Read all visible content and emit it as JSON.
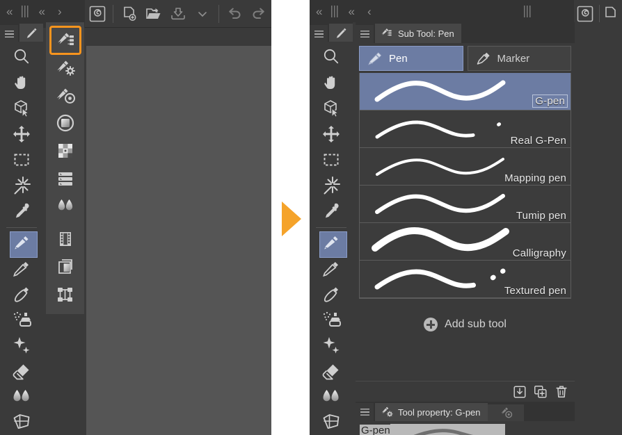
{
  "app": {
    "name": "Clip Studio Paint",
    "accent_orange": "#f7941e",
    "accent_blue": "#6c7ca3",
    "panel_bg": "#3a3a3a",
    "window_bg": "#333333",
    "canvas_bg": "#555555"
  },
  "left_window": {
    "navbar": {
      "collapse_all": "«",
      "grip": "grip",
      "collapse": "«",
      "expand": "›"
    },
    "command_bar": {
      "items": [
        {
          "name": "csp-logo-icon",
          "label": "Clip Studio Paint"
        },
        {
          "name": "new-file-icon",
          "label": "New"
        },
        {
          "name": "open-file-icon",
          "label": "Open"
        },
        {
          "name": "save-icon",
          "label": "Save"
        },
        {
          "name": "chevron-down-icon",
          "label": "More"
        },
        {
          "name": "undo-icon",
          "label": "Undo"
        },
        {
          "name": "redo-icon",
          "label": "Redo"
        }
      ]
    },
    "tool_tab": {
      "menu": "menu-icon",
      "icon": "pencil-icon"
    },
    "tools": [
      {
        "name": "zoom-tool",
        "label": "Zoom",
        "selected": false
      },
      {
        "name": "move-canvas-tool",
        "label": "Move canvas",
        "selected": false
      },
      {
        "name": "rotate-3d-tool",
        "label": "Object",
        "selected": false
      },
      {
        "name": "move-tool",
        "label": "Move layer",
        "selected": false
      },
      {
        "name": "selection-tool",
        "label": "Selection area",
        "selected": false
      },
      {
        "name": "auto-select-tool",
        "label": "Auto select",
        "selected": false
      },
      {
        "name": "eyedropper-tool",
        "label": "Eyedropper",
        "selected": false
      },
      {
        "name": "pen-tool",
        "label": "Pen",
        "selected": true
      },
      {
        "name": "pencil-tool",
        "label": "Pencil",
        "selected": false
      },
      {
        "name": "brush-tool",
        "label": "Brush",
        "selected": false
      },
      {
        "name": "airbrush-tool",
        "label": "Airbrush",
        "selected": false
      },
      {
        "name": "decoration-tool",
        "label": "Decoration",
        "selected": false
      },
      {
        "name": "eraser-tool",
        "label": "Eraser",
        "selected": false
      },
      {
        "name": "blend-tool",
        "label": "Blend",
        "selected": false
      },
      {
        "name": "gradient-tool",
        "label": "Gradient",
        "selected": false
      }
    ],
    "sub_tool_icons": [
      {
        "name": "sub-tool-list-icon",
        "label": "Sub Tool",
        "highlighted": true
      },
      {
        "name": "tool-property-icon",
        "label": "Tool property",
        "highlighted": false
      },
      {
        "name": "brush-settings-icon",
        "label": "Sub Tool Detail",
        "highlighted": false
      },
      {
        "name": "color-circle-icon",
        "label": "Color Wheel",
        "highlighted": false
      },
      {
        "name": "color-set-icon",
        "label": "Color Set",
        "highlighted": false
      },
      {
        "name": "layer-property-icon",
        "label": "Layer Property",
        "highlighted": false
      },
      {
        "name": "gradient-set-icon",
        "label": "Gradient",
        "highlighted": false
      },
      {
        "name": "timeline-icon",
        "label": "Timeline",
        "highlighted": false
      },
      {
        "name": "layers-icon",
        "label": "Layer",
        "highlighted": false
      },
      {
        "name": "material-icon",
        "label": "Material",
        "highlighted": false
      }
    ]
  },
  "right_window": {
    "navbar": {
      "collapse_all": "«",
      "grip": "grip",
      "collapse": "«",
      "back": "‹",
      "grip2": "grip"
    },
    "command_bar": {
      "items": [
        {
          "name": "csp-logo-icon",
          "label": "Clip Studio Paint"
        },
        {
          "name": "new-file-icon",
          "label": "New"
        }
      ]
    },
    "tool_tab": {
      "menu": "menu-icon",
      "icon": "pencil-icon"
    },
    "sub_tool_panel": {
      "menu": "menu-icon",
      "tab_icon": "sub-tool-icon",
      "tab_title": "Sub Tool: Pen",
      "groups": [
        {
          "name": "group-pen",
          "label": "Pen",
          "icon": "pen-nib-icon",
          "active": true
        },
        {
          "name": "group-marker",
          "label": "Marker",
          "icon": "marker-icon",
          "active": false
        }
      ],
      "sub_tools": [
        {
          "name": "sub-tool-g-pen",
          "label": "G-pen",
          "selected": true,
          "stroke": "smooth-thick"
        },
        {
          "name": "sub-tool-real-g-pen",
          "label": "Real G-Pen",
          "selected": false,
          "stroke": "rough-thin"
        },
        {
          "name": "sub-tool-mapping-pen",
          "label": "Mapping pen",
          "selected": false,
          "stroke": "smooth-thin"
        },
        {
          "name": "sub-tool-turnip-pen",
          "label": "Tumip pen",
          "selected": false,
          "stroke": "smooth-medium"
        },
        {
          "name": "sub-tool-calligraphy",
          "label": "Calligraphy",
          "selected": false,
          "stroke": "smooth-thickest"
        },
        {
          "name": "sub-tool-textured-pen",
          "label": "Textured pen",
          "selected": false,
          "stroke": "textured"
        }
      ],
      "add_sub_tool": {
        "label": "Add sub tool",
        "icon": "plus-circle-icon"
      },
      "footer_buttons": [
        {
          "name": "import-sub-tool-icon",
          "label": "Import sub tool"
        },
        {
          "name": "duplicate-sub-tool-icon",
          "label": "Duplicate sub tool"
        },
        {
          "name": "delete-sub-tool-icon",
          "label": "Delete sub tool"
        }
      ]
    },
    "tool_property_panel": {
      "menu": "menu-icon",
      "tab_icon": "tool-property-icon",
      "tab_title": "Tool property: G-pen",
      "secondary_tab_icon": "sub-tool-detail-icon",
      "value_label": "G-pen"
    }
  }
}
